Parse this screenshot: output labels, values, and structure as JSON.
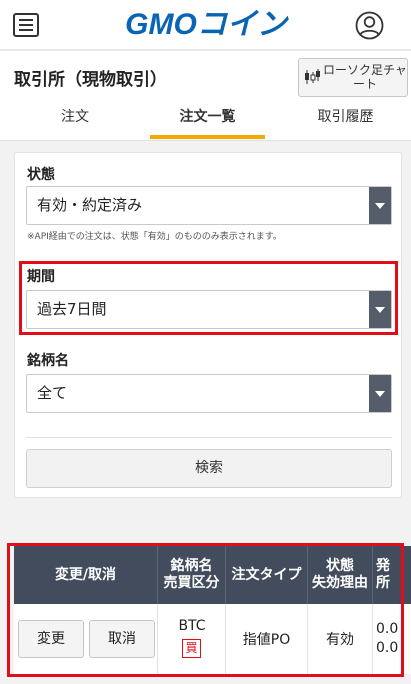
{
  "header": {
    "logo": "GMOコイン",
    "menu_icon": "hamburger-menu-icon",
    "user_icon": "user-account-icon"
  },
  "page": {
    "title": "取引所（現物取引）",
    "chart_button": "ローソク足チャート",
    "chart_icon": "candlestick-chart-icon"
  },
  "tabs": [
    {
      "label": "注文",
      "active": false
    },
    {
      "label": "注文一覧",
      "active": true
    },
    {
      "label": "取引履歴",
      "active": false
    }
  ],
  "filters": {
    "status": {
      "label": "状態",
      "value": "有効・約定済み"
    },
    "note": "※API経由での注文は、状態「有効」のもののみ表示されます。",
    "period": {
      "label": "期間",
      "value": "過去7日間"
    },
    "symbol": {
      "label": "銘柄名",
      "value": "全て"
    },
    "search_button": "検索"
  },
  "orders_table": {
    "headers": {
      "action": "変更/取消",
      "symbol_line1": "銘柄名",
      "symbol_line2": "売買区分",
      "order_type": "注文タイプ",
      "status_line1": "状態",
      "status_line2": "失効理由",
      "next_line1": "発",
      "next_line2": "所"
    },
    "rows": [
      {
        "change_button": "変更",
        "cancel_button": "取消",
        "symbol": "BTC",
        "side": "買",
        "order_type": "指値PO",
        "status": "有効",
        "qty_line1": "0.0",
        "qty_line2": "0.0"
      }
    ]
  },
  "colors": {
    "accent_tab": "#f2a800",
    "highlight": "#e10d18",
    "table_header": "#424c5c",
    "logo_blue": "#0a64b4"
  }
}
